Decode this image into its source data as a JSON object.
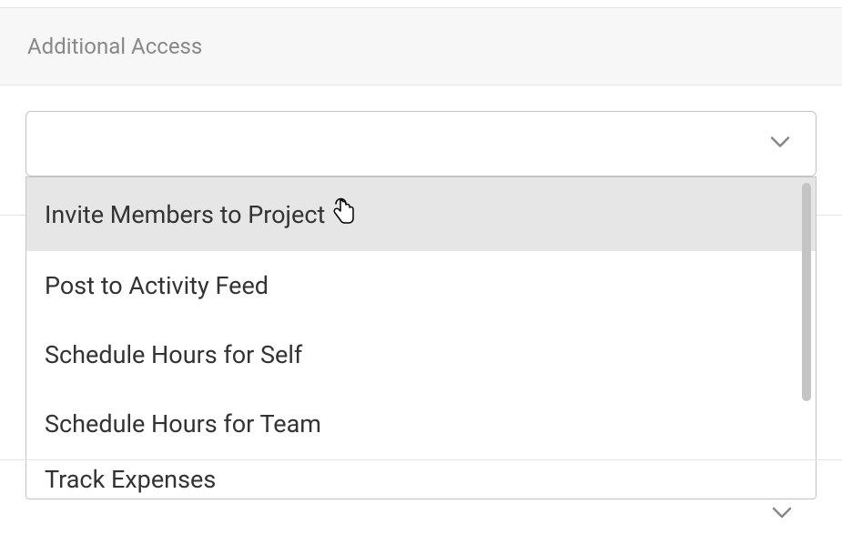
{
  "header": {
    "title": "Additional Access"
  },
  "dropdown": {
    "options": [
      {
        "label": "Invite Members to Project",
        "hovered": true
      },
      {
        "label": "Post to Activity Feed",
        "hovered": false
      },
      {
        "label": "Schedule Hours for Self",
        "hovered": false
      },
      {
        "label": "Schedule Hours for Team",
        "hovered": false
      },
      {
        "label": "Track Expenses",
        "hovered": false
      }
    ]
  }
}
